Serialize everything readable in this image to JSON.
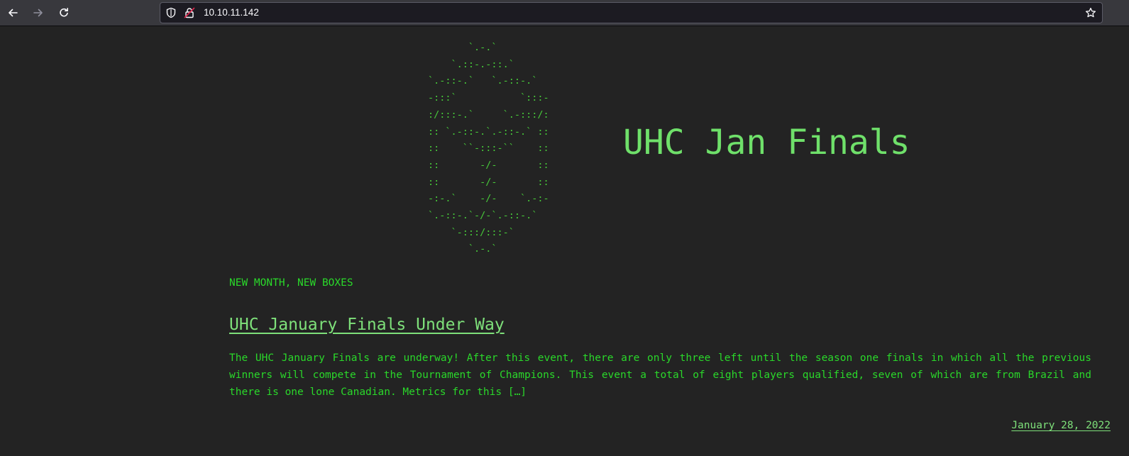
{
  "browser": {
    "url": "10.10.11.142",
    "icons": {
      "back": "arrow-left-icon",
      "forward": "arrow-right-icon",
      "reload": "reload-icon",
      "tracking_protection": "shield-icon",
      "connection": "insecure-lock-icon",
      "bookmark": "star-icon"
    }
  },
  "site": {
    "ascii_logo": "       `.-.`\n    `.::-.-::.`\n`.-::-.`   `.-::-.`\n-:::`           `:::-\n:/:::-.`     `.-:::/:\n:: `.-::-.`.-::-.` ::\n::    ``-:::-``    ::\n::       -/-       ::\n::       -/-       ::\n-:-.`    -/-    `.-:-\n`.-::-.`-/-`.-::-.`\n    `-:::/:::-`\n       `.-.`",
    "title": "UHC Jan Finals"
  },
  "post": {
    "category": "NEW MONTH, NEW BOXES",
    "title": "UHC January Finals Under Way",
    "excerpt": "The UHC January Finals are underway! After this event, there are only three left until the season one finals in which all the previous winners will compete in the Tournament of Champions. This event a total of eight players qualified, seven of which are from Brazil and there is one lone Canadian. Metrics for this […]",
    "date": "January 28, 2022"
  },
  "colors": {
    "page_background": "#232323",
    "toolbar_background": "#38383d",
    "urlbar_background": "#1c1b22",
    "text_green": "#2ad82a",
    "link_green": "#7ee07a",
    "logo_green": "#47c83a"
  }
}
